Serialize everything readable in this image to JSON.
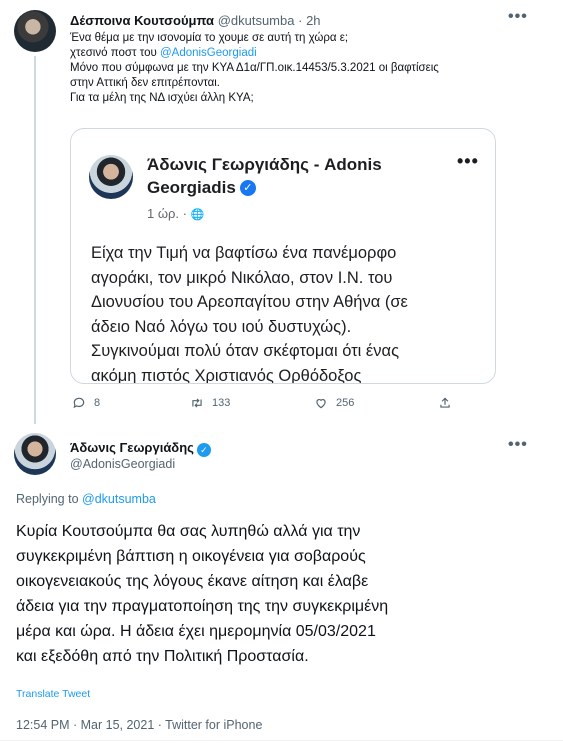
{
  "tweet1": {
    "author_name": "Δέσποινα Κουτσούμπα",
    "author_handle": "@dkutsumba",
    "separator": "·",
    "time": "2h",
    "more": "•••",
    "text_lines": [
      "Ένα θέμα με την ισονομία το χουμε σε αυτή τη χώρα ε;",
      "Μόνο που σύμφωνα με την ΚΥΑ Δ1α/ΓΠ.οικ.14453/5.3.2021 οι βαφτίσεις",
      "στην Αττική δεν επιτρέπονται.",
      "Για τα μέλη της ΝΔ ισχύει άλλη ΚΥΑ;"
    ],
    "line2_prefix": "χτεσινό ποστ του ",
    "line2_mention": "@AdonisGeorgiadi",
    "quote": {
      "page_name_line1": "Άδωνις Γεωργιάδης - Adonis",
      "page_name_line2": "Georgiadis",
      "verified_mark": "✓",
      "time": "1 ώρ. · ",
      "globe": "🌐",
      "more": "•••",
      "text_lines": [
        "Είχα την Τιμή να βαφτίσω ένα πανέμορφο",
        "αγοράκι, τον μικρό Νικόλαο, στον Ι.Ν. του",
        "Διονυσίου του Αρεοπαγίτου στην Αθήνα (σε",
        "άδειο Ναό λόγω του ιού δυστυχώς).",
        "Συγκινούμαι πολύ όταν σκέφτομαι ότι ένας",
        "ακόμη πιστός Χριστιανός Ορθόδοξος"
      ]
    },
    "replies": "8",
    "retweets": "133",
    "likes": "256"
  },
  "tweet2": {
    "author_name": "Άδωνις Γεωργιάδης",
    "verified_mark": "✓",
    "author_handle": "@AdonisGeorgiadi",
    "more": "•••",
    "replying_prefix": "Replying to ",
    "replying_to": "@dkutsumba",
    "text_lines": [
      "Κυρία Κουτσούμπα θα σας λυπηθώ αλλά για την",
      "συγκεκριμένη βάπτιση η οικογένεια για σοβαρούς",
      "οικογενειακούς της λόγους έκανε αίτηση και έλαβε",
      "άδεια για την πραγματοποίηση της την συγκεκριμένη",
      "μέρα και ώρα. Η άδεια έχει ημερομηνία 05/03/2021",
      "και εξεδόθη από την Πολιτική Προστασία."
    ],
    "translate": "Translate Tweet",
    "meta": "12:54 PM · Mar 15, 2021 · Twitter for iPhone"
  },
  "colors": {
    "accent": "#1d9bf0",
    "muted": "#536471",
    "fb_blue": "#1877f2"
  },
  "icons": [
    "reply-icon",
    "retweet-icon",
    "like-icon",
    "share-icon",
    "globe-icon",
    "verified-icon",
    "more-icon"
  ]
}
